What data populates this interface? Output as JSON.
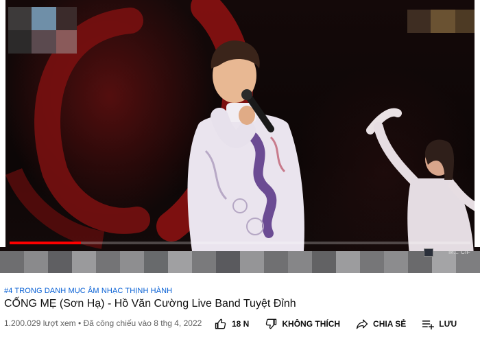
{
  "video": {
    "progress_fraction": 0.155
  },
  "player_controls": {
    "channel_text": "M... CIF"
  },
  "metadata": {
    "hashtag": "#4 TRONG DANH MỤC ÂM NHẠC THỊNH HÀNH",
    "title": "CỐNG MẸ (Sơn Hạ) - Hồ Văn Cường Live Band Tuyệt Đỉnh",
    "stats": "1.200.029 lượt xem • Đã công chiếu vào 8 thg 4, 2022"
  },
  "actions": {
    "like_count": "18 N",
    "dislike_label": "KHÔNG THÍCH",
    "share_label": "CHIA SẺ",
    "save_label": "LƯU"
  },
  "colors": {
    "progress": "#ff0000",
    "hashtag": "#065fd4",
    "stage_accent": "#8c1414"
  },
  "icons": [
    "thumbs-up-icon",
    "thumbs-down-icon",
    "share-icon",
    "save-playlist-icon"
  ]
}
